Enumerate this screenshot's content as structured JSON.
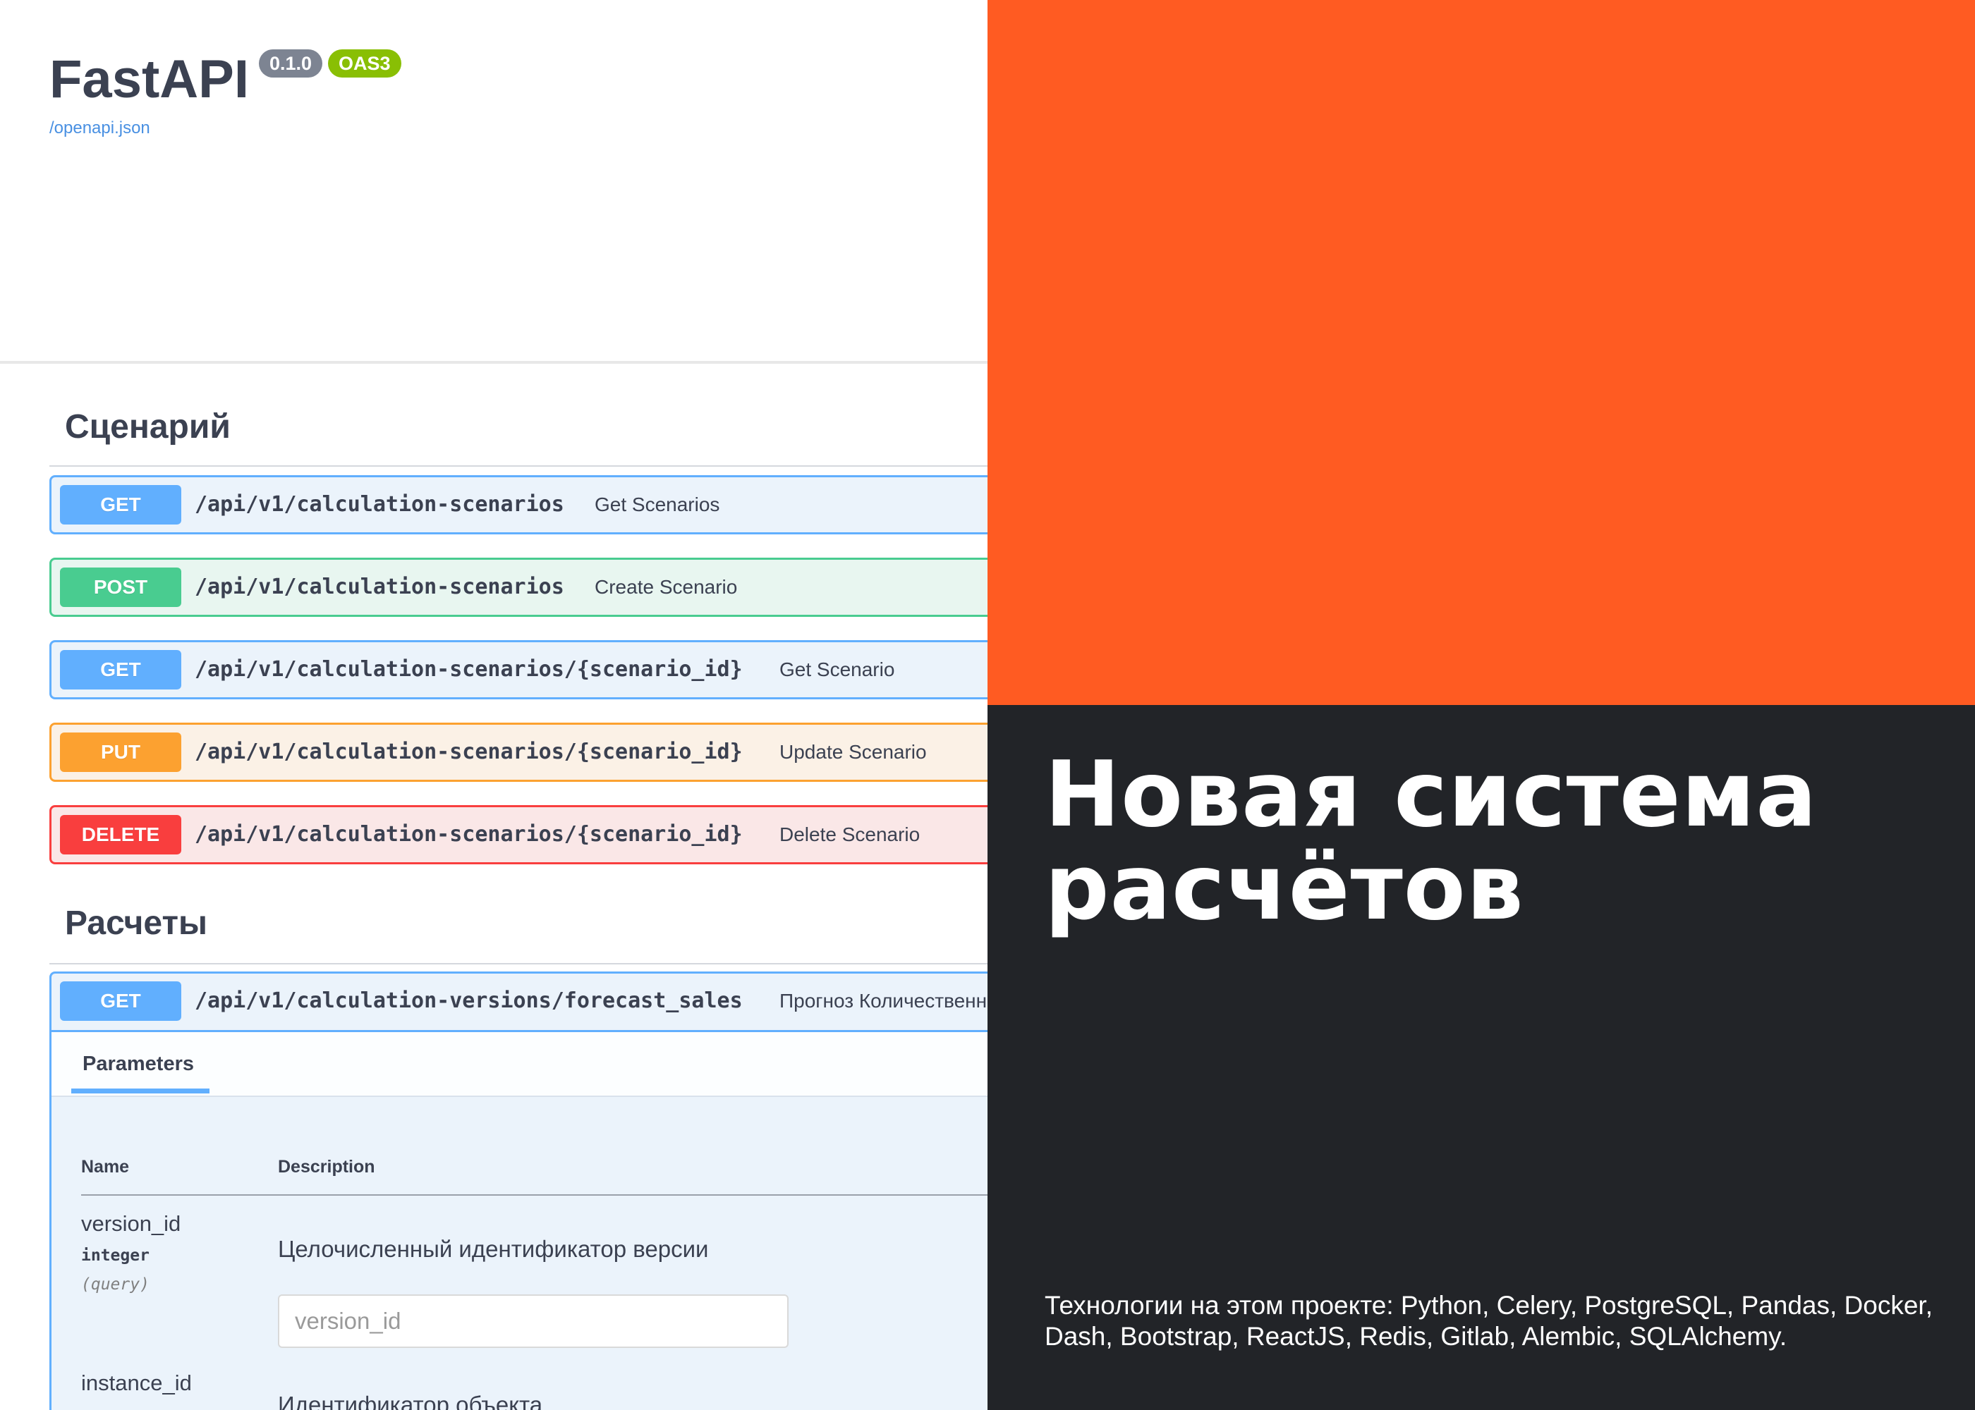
{
  "swagger": {
    "title": "FastAPI",
    "version_badge": "0.1.0",
    "oas_badge": "OAS3",
    "openapi_link": "/openapi.json",
    "sections": [
      {
        "title": "Сценарий",
        "operations": [
          {
            "method": "GET",
            "path": "/api/v1/calculation-scenarios",
            "summary": "Get Scenarios"
          },
          {
            "method": "POST",
            "path": "/api/v1/calculation-scenarios",
            "summary": "Create Scenario"
          },
          {
            "method": "GET",
            "path": "/api/v1/calculation-scenarios/{scenario_id}",
            "summary": "Get Scenario"
          },
          {
            "method": "PUT",
            "path": "/api/v1/calculation-scenarios/{scenario_id}",
            "summary": "Update Scenario"
          },
          {
            "method": "DELETE",
            "path": "/api/v1/calculation-scenarios/{scenario_id}",
            "summary": "Delete Scenario"
          }
        ]
      },
      {
        "title": "Расчеты",
        "operations": [
          {
            "method": "GET",
            "path": "/api/v1/calculation-versions/forecast_sales",
            "summary": "Прогноз Количественне"
          }
        ]
      }
    ],
    "expanded": {
      "tab": "Parameters",
      "col_name": "Name",
      "col_description": "Description",
      "params": [
        {
          "name": "version_id",
          "type": "integer",
          "in": "(query)",
          "description": "Целочисленный идентификатор версии",
          "placeholder": "version_id"
        },
        {
          "name": "instance_id",
          "type": "",
          "in": "",
          "description": "Идентификатор объекта",
          "placeholder": ""
        }
      ]
    }
  },
  "promo": {
    "headline_line1": "Новая система",
    "headline_line2": "расчётов",
    "technologies": "Технологии на этом проекте: Python, Celery, PostgreSQL, Pandas, Docker, Dash, Bootstrap, ReactJS, Redis, Gitlab, Alembic, SQLAlchemy.",
    "colors": {
      "orange": "#ff5b22",
      "dark": "#222428"
    }
  }
}
